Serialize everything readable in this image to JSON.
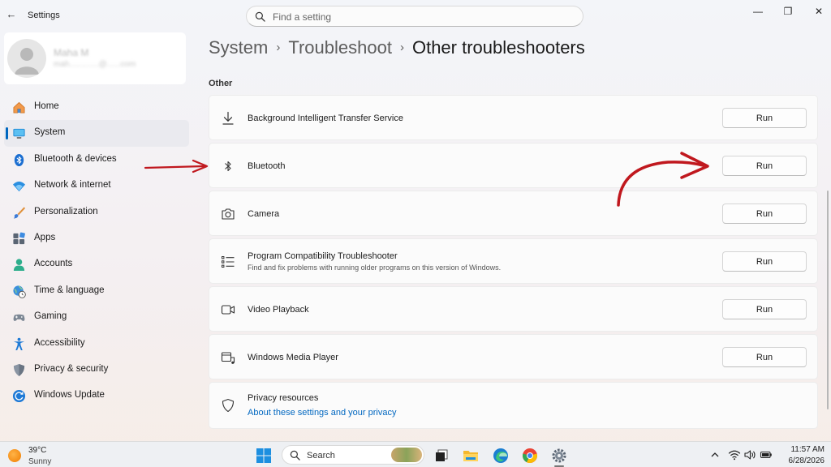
{
  "window": {
    "title": "Settings",
    "controls": {
      "minimize": "—",
      "restore": "❐",
      "close": "✕"
    }
  },
  "search": {
    "placeholder": "Find a setting"
  },
  "profile": {
    "name": "Maha M",
    "email": "mah.............@......com"
  },
  "sidebar": {
    "items": [
      {
        "label": "Home",
        "icon": "home-icon"
      },
      {
        "label": "System",
        "icon": "monitor-icon",
        "active": true
      },
      {
        "label": "Bluetooth & devices",
        "icon": "bluetooth-icon"
      },
      {
        "label": "Network & internet",
        "icon": "wifi-icon"
      },
      {
        "label": "Personalization",
        "icon": "brush-icon"
      },
      {
        "label": "Apps",
        "icon": "apps-icon"
      },
      {
        "label": "Accounts",
        "icon": "person-icon"
      },
      {
        "label": "Time & language",
        "icon": "globe-clock-icon"
      },
      {
        "label": "Gaming",
        "icon": "gamepad-icon"
      },
      {
        "label": "Accessibility",
        "icon": "accessibility-icon"
      },
      {
        "label": "Privacy & security",
        "icon": "shield-icon"
      },
      {
        "label": "Windows Update",
        "icon": "update-icon"
      }
    ]
  },
  "breadcrumb": {
    "system": "System",
    "sep": "›",
    "troubleshoot": "Troubleshoot",
    "current": "Other troubleshooters"
  },
  "section": {
    "label": "Other"
  },
  "troubleshooters": [
    {
      "title": "Background Intelligent Transfer Service",
      "icon": "download-icon",
      "button": "Run"
    },
    {
      "title": "Bluetooth",
      "icon": "bluetooth-icon",
      "button": "Run"
    },
    {
      "title": "Camera",
      "icon": "camera-icon",
      "button": "Run"
    },
    {
      "title": "Program Compatibility Troubleshooter",
      "subtitle": "Find and fix problems with running older programs on this version of Windows.",
      "icon": "list-icon",
      "button": "Run"
    },
    {
      "title": "Video Playback",
      "icon": "video-icon",
      "button": "Run"
    },
    {
      "title": "Windows Media Player",
      "icon": "media-player-icon",
      "button": "Run"
    }
  ],
  "privacy": {
    "title": "Privacy resources",
    "link": "About these settings and your privacy",
    "icon": "shield-icon"
  },
  "colors": {
    "accent": "#0067c0",
    "annotation": "#c0181e"
  },
  "taskbar": {
    "weather": {
      "temp": "39°C",
      "condition": "Sunny"
    },
    "search_label": "Search",
    "clock": {
      "time": "11:57 AM",
      "date": "6/28/2026"
    }
  }
}
